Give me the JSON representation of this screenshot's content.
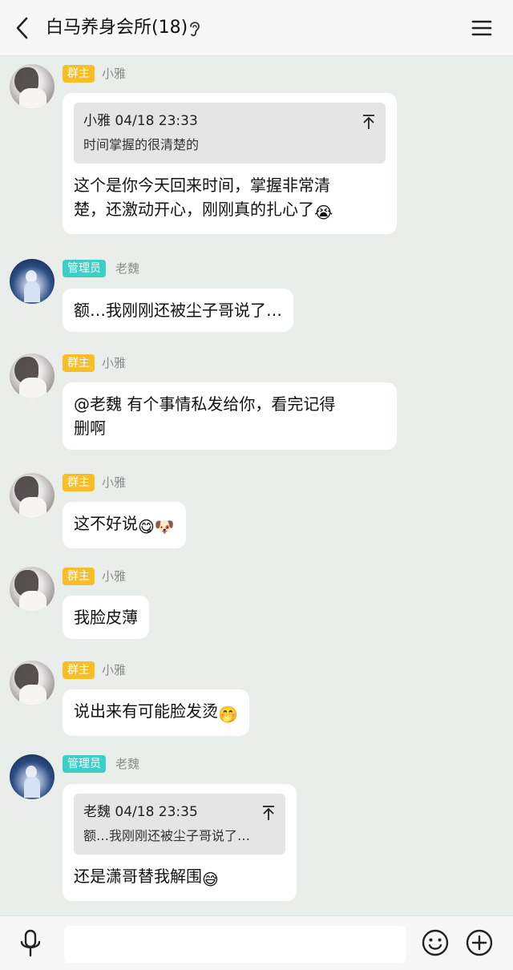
{
  "header": {
    "title": "白马养身会所(18)",
    "back_icon": "chevron-left-icon",
    "ear_icon": "ear-icon",
    "menu_icon": "menu-icon"
  },
  "messages": [
    {
      "role": "群主",
      "sender": "小雅",
      "quote": {
        "head": "小雅 04/18 23:33",
        "text": "时间掌握的很清楚的"
      },
      "lines": [
        "这个是你今天回来时间，掌握非常清",
        "楚，还激动开心，刚刚真的扎心了"
      ],
      "emoji": "😭"
    },
    {
      "role": "管理员",
      "sender": "老魏",
      "lines": [
        "额…我刚刚还被尘子哥说了…"
      ]
    },
    {
      "role": "群主",
      "sender": "小雅",
      "lines": [
        "@老魏 有个事情私发给你，看完记得",
        "删啊"
      ]
    },
    {
      "role": "群主",
      "sender": "小雅",
      "lines": [
        "这不好说"
      ],
      "emoji": "😋🐶"
    },
    {
      "role": "群主",
      "sender": "小雅",
      "lines": [
        "我脸皮薄"
      ]
    },
    {
      "role": "群主",
      "sender": "小雅",
      "lines": [
        "说出来有可能脸发烫"
      ],
      "emoji": "🤭"
    },
    {
      "role": "管理员",
      "sender": "老魏",
      "quote": {
        "head": "老魏 04/18 23:35",
        "text": "额…我刚刚还被尘子哥说了…"
      },
      "lines": [
        "还是潇哥替我解围"
      ],
      "emoji": "😅"
    }
  ],
  "bottom": {
    "input_value": "",
    "mic_icon": "mic-icon",
    "emoji_icon": "smiley-icon",
    "plus_icon": "plus-icon"
  },
  "colors": {
    "background": "#e9eeea",
    "owner_badge": "#f7be2a",
    "admin_badge": "#3ccfc7",
    "bubble": "#ffffff",
    "quote_bg": "#e5e5e5"
  }
}
